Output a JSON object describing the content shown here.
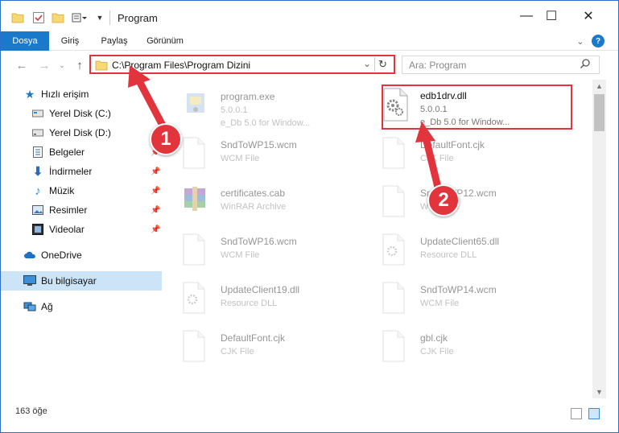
{
  "window": {
    "title": "Program",
    "controls": {
      "minimize": "—",
      "maximize": "☐",
      "close": "✕"
    }
  },
  "ribbon": {
    "tabs": [
      "Dosya",
      "Giriş",
      "Paylaş",
      "Görünüm"
    ],
    "expand_icon": "chevron-down-icon",
    "help_label": "?"
  },
  "navigation": {
    "address_path": "C:\\Program Files\\Program Dizini",
    "search_placeholder": "Ara: Program"
  },
  "sidebar": {
    "items": [
      {
        "label": "Hızlı erişim",
        "icon": "star-icon",
        "pinned": false
      },
      {
        "label": "Yerel Disk (C:)",
        "icon": "drive-icon",
        "pinned": false
      },
      {
        "label": "Yerel Disk (D:)",
        "icon": "drive-icon",
        "pinned": false
      },
      {
        "label": "Belgeler",
        "icon": "documents-icon",
        "pinned": true
      },
      {
        "label": "İndirmeler",
        "icon": "download-icon",
        "pinned": true
      },
      {
        "label": "Müzik",
        "icon": "music-icon",
        "pinned": true
      },
      {
        "label": "Resimler",
        "icon": "pictures-icon",
        "pinned": true
      },
      {
        "label": "Videolar",
        "icon": "videos-icon",
        "pinned": true
      },
      {
        "label": "OneDrive",
        "icon": "cloud-icon",
        "pinned": false
      },
      {
        "label": "Bu bilgisayar",
        "icon": "computer-icon",
        "pinned": false
      },
      {
        "label": "Ağ",
        "icon": "network-icon",
        "pinned": false
      }
    ]
  },
  "files": [
    {
      "name": "program.exe",
      "line2": "5.0.0.1",
      "line3": "e_Db 5.0 for Window...",
      "icon": "exe-icon"
    },
    {
      "name": "edb1drv.dll",
      "line2": "5.0.0.1",
      "line3": "e_Db 5.0 for Window...",
      "icon": "dll-gear-icon"
    },
    {
      "name": "SndToWP15.wcm",
      "line2": "WCM File",
      "line3": "",
      "icon": "file-icon"
    },
    {
      "name": "DefaultFont.cjk",
      "line2": "CJK File",
      "line3": "",
      "icon": "file-icon"
    },
    {
      "name": "certificates.cab",
      "line2": "WinRAR Archive",
      "line3": "",
      "icon": "rar-icon"
    },
    {
      "name": "SndToWP12.wcm",
      "line2": "WCM File",
      "line3": "",
      "icon": "file-icon"
    },
    {
      "name": "SndToWP16.wcm",
      "line2": "WCM File",
      "line3": "",
      "icon": "file-icon"
    },
    {
      "name": "UpdateClient65.dll",
      "line2": "Resource DLL",
      "line3": "",
      "icon": "dll-gear-icon"
    },
    {
      "name": "UpdateClient19.dll",
      "line2": "Resource DLL",
      "line3": "",
      "icon": "dll-gear-icon"
    },
    {
      "name": "SndToWP14.wcm",
      "line2": "WCM File",
      "line3": "",
      "icon": "file-icon"
    },
    {
      "name": "DefaultFont.cjk",
      "line2": "CJK File",
      "line3": "",
      "icon": "file-icon"
    },
    {
      "name": "gbl.cjk",
      "line2": "CJK File",
      "line3": "",
      "icon": "file-icon"
    }
  ],
  "status": {
    "item_count": "163 öğe"
  },
  "annotations": {
    "step1": "1",
    "step2": "2"
  },
  "colors": {
    "accent": "#1979ca",
    "highlight": "#e1343c",
    "selected": "#cce4f7"
  }
}
